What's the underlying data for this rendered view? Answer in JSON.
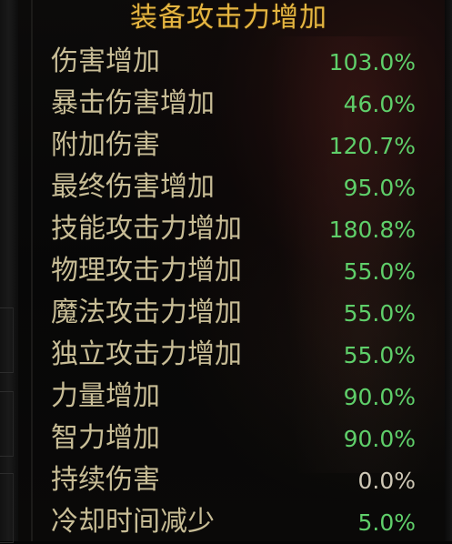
{
  "panel": {
    "title": "装备攻击力增加",
    "stats": [
      {
        "label": "伤害增加",
        "value": "103.0%"
      },
      {
        "label": "暴击伤害增加",
        "value": "46.0%"
      },
      {
        "label": "附加伤害",
        "value": "120.7%"
      },
      {
        "label": "最终伤害增加",
        "value": "95.0%"
      },
      {
        "label": "技能攻击力增加",
        "value": "180.8%"
      },
      {
        "label": "物理攻击力增加",
        "value": "55.0%"
      },
      {
        "label": "魔法攻击力增加",
        "value": "55.0%"
      },
      {
        "label": "独立攻击力增加",
        "value": "55.0%"
      },
      {
        "label": "力量增加",
        "value": "90.0%"
      },
      {
        "label": "智力增加",
        "value": "90.0%"
      },
      {
        "label": "持续伤害",
        "value": "0.0%"
      },
      {
        "label": "冷却时间减少",
        "value": "5.0%"
      }
    ]
  },
  "colors": {
    "title": "#e5b541",
    "label": "#c8bd96",
    "value_positive": "#5fcf6a",
    "value_zero": "#cfc8b6",
    "background": "#070707"
  }
}
